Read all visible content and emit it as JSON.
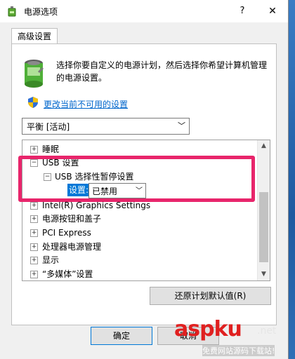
{
  "window": {
    "title": "电源选项",
    "help": "?",
    "close": "✕"
  },
  "tab": {
    "label": "高级设置"
  },
  "description": "选择你要自定义的电源计划，然后选择你希望计算机管理的电源设置。",
  "link": "更改当前不可用的设置",
  "plan_select": {
    "value": "平衡 [活动]"
  },
  "tree": {
    "items": [
      {
        "label": "睡眠",
        "expander": "+",
        "level": 0
      },
      {
        "label": "USB 设置",
        "expander": "−",
        "level": 0
      },
      {
        "label": "USB 选择性暂停设置",
        "expander": "−",
        "level": 1
      },
      {
        "label": "Intel(R) Graphics Settings",
        "expander": "+",
        "level": 0
      },
      {
        "label": "电源按钮和盖子",
        "expander": "+",
        "level": 0
      },
      {
        "label": "PCI Express",
        "expander": "+",
        "level": 0
      },
      {
        "label": "处理器电源管理",
        "expander": "+",
        "level": 0
      },
      {
        "label": "显示",
        "expander": "+",
        "level": 0
      },
      {
        "label": "“多媒体”设置",
        "expander": "+",
        "level": 0
      }
    ],
    "setting": {
      "label": "设置:",
      "value": "已禁用"
    }
  },
  "buttons": {
    "restore": "还原计划默认值(R)",
    "ok": "确定",
    "cancel": "取消"
  },
  "watermark": {
    "main": "aspku",
    "net": ".net",
    "sub": "免费网站源码下载站!"
  },
  "colors": {
    "accent": "#0078d7",
    "highlight": "#e8256b",
    "link": "#0066cc"
  }
}
